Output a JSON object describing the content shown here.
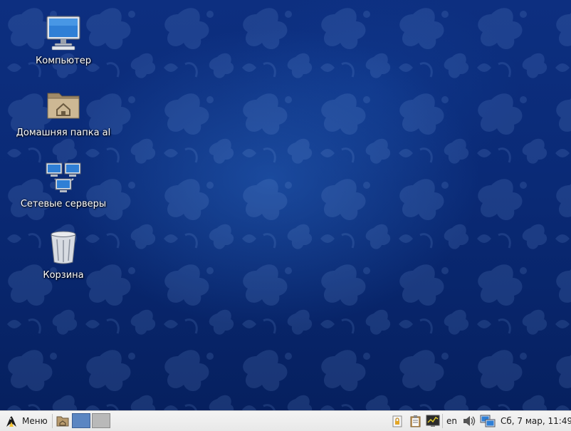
{
  "desktop": {
    "icons": [
      {
        "name": "computer-icon",
        "label": "Компьютер"
      },
      {
        "name": "home-folder-icon",
        "label": "Домашняя папка al"
      },
      {
        "name": "network-servers-icon",
        "label": "Сетевые серверы"
      },
      {
        "name": "trash-icon",
        "label": "Корзина"
      }
    ],
    "colors": {
      "background": "#0a2a76",
      "label": "#ffffff"
    }
  },
  "taskbar": {
    "menu_label": "Меню",
    "menu_icon": "linux-mascot-icon",
    "file_manager_icon": "file-manager-icon",
    "workspaces": [
      {
        "state": "active"
      },
      {
        "state": "inactive"
      }
    ],
    "tray": {
      "lock_icon": "screen-lock-icon",
      "clipboard_icon": "clipboard-icon",
      "monitor_icon": "system-monitor-icon",
      "language": "en",
      "volume_icon": "volume-icon",
      "network_icon": "network-icon",
      "clock": "Сб,  7 мар, 11:49"
    }
  }
}
